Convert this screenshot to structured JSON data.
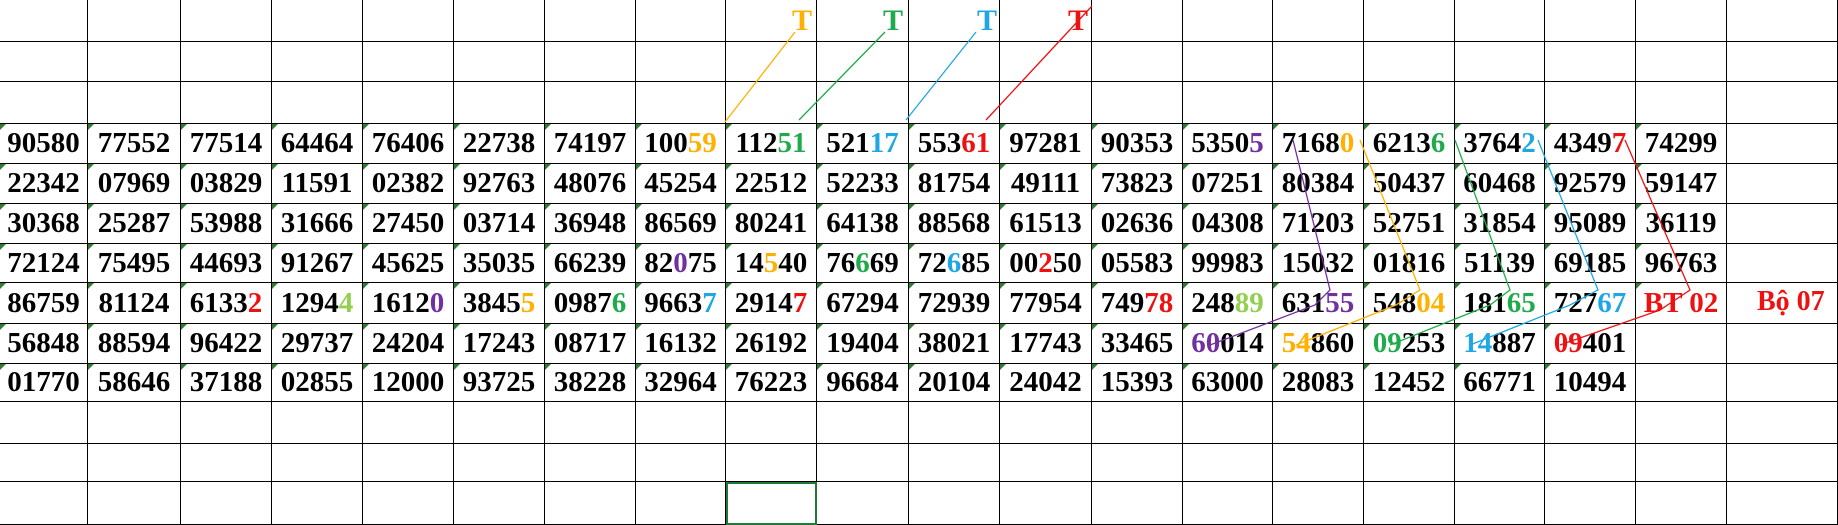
{
  "colors": {
    "orange": "#ffb000",
    "green": "#1faa4b",
    "blue": "#1ea7e4",
    "red": "#ee1111",
    "purple": "#7030a0",
    "lime": "#92d050",
    "black": "#000000",
    "grid": "#000000",
    "cell_marker": "#2e7d32"
  },
  "top_marks": [
    {
      "text": "T",
      "col": 8,
      "color": "orange"
    },
    {
      "text": "T",
      "col": 9,
      "color": "green"
    },
    {
      "text": "T",
      "col": 10,
      "color": "blue"
    },
    {
      "text": "T",
      "col": 11,
      "color": "red"
    }
  ],
  "rows": [
    [
      [
        {
          "t": "90580"
        }
      ],
      [
        {
          "t": "77552"
        }
      ],
      [
        {
          "t": "77514"
        }
      ],
      [
        {
          "t": "64464"
        }
      ],
      [
        {
          "t": "76406"
        }
      ],
      [
        {
          "t": "22738"
        }
      ],
      [
        {
          "t": "74197"
        }
      ],
      [
        {
          "t": "100"
        },
        {
          "t": "59",
          "c": "orange"
        }
      ],
      [
        {
          "t": "112"
        },
        {
          "t": "51",
          "c": "green"
        }
      ],
      [
        {
          "t": "521"
        },
        {
          "t": "17",
          "c": "blue"
        }
      ],
      [
        {
          "t": "553"
        },
        {
          "t": "61",
          "c": "red"
        }
      ],
      [
        {
          "t": "97281"
        }
      ],
      [
        {
          "t": "90353"
        }
      ],
      [
        {
          "t": "5350"
        },
        {
          "t": "5",
          "c": "purple"
        }
      ],
      [
        {
          "t": "7168"
        },
        {
          "t": "0",
          "c": "orange"
        }
      ],
      [
        {
          "t": "6213"
        },
        {
          "t": "6",
          "c": "green"
        }
      ],
      [
        {
          "t": "3764"
        },
        {
          "t": "2",
          "c": "blue"
        }
      ],
      [
        {
          "t": "4349"
        },
        {
          "t": "7",
          "c": "red"
        }
      ],
      [
        {
          "t": "74299"
        }
      ],
      [
        {
          "t": ""
        }
      ]
    ],
    [
      [
        {
          "t": "22342"
        }
      ],
      [
        {
          "t": "07969"
        }
      ],
      [
        {
          "t": "03829"
        }
      ],
      [
        {
          "t": "11591"
        }
      ],
      [
        {
          "t": "02382"
        }
      ],
      [
        {
          "t": "92763"
        }
      ],
      [
        {
          "t": "48076"
        }
      ],
      [
        {
          "t": "45254"
        }
      ],
      [
        {
          "t": "22512"
        }
      ],
      [
        {
          "t": "52233"
        }
      ],
      [
        {
          "t": "81754"
        }
      ],
      [
        {
          "t": "49111"
        }
      ],
      [
        {
          "t": "73823"
        }
      ],
      [
        {
          "t": "07251"
        }
      ],
      [
        {
          "t": "80384"
        }
      ],
      [
        {
          "t": "50437"
        }
      ],
      [
        {
          "t": "60468"
        }
      ],
      [
        {
          "t": "92579"
        }
      ],
      [
        {
          "t": "59147"
        }
      ],
      [
        {
          "t": ""
        }
      ]
    ],
    [
      [
        {
          "t": "30368"
        }
      ],
      [
        {
          "t": "25287"
        }
      ],
      [
        {
          "t": "53988"
        }
      ],
      [
        {
          "t": "31666"
        }
      ],
      [
        {
          "t": "27450"
        }
      ],
      [
        {
          "t": "03714"
        }
      ],
      [
        {
          "t": "36948"
        }
      ],
      [
        {
          "t": "86569"
        }
      ],
      [
        {
          "t": "80241"
        }
      ],
      [
        {
          "t": "64138"
        }
      ],
      [
        {
          "t": "88568"
        }
      ],
      [
        {
          "t": "61513"
        }
      ],
      [
        {
          "t": "02636"
        }
      ],
      [
        {
          "t": "04308"
        }
      ],
      [
        {
          "t": "71203"
        }
      ],
      [
        {
          "t": "52751"
        }
      ],
      [
        {
          "t": "31854"
        }
      ],
      [
        {
          "t": "95089"
        }
      ],
      [
        {
          "t": "36119"
        }
      ],
      [
        {
          "t": ""
        }
      ]
    ],
    [
      [
        {
          "t": "72124"
        }
      ],
      [
        {
          "t": "75495"
        }
      ],
      [
        {
          "t": "44693"
        }
      ],
      [
        {
          "t": "91267"
        }
      ],
      [
        {
          "t": "45625"
        }
      ],
      [
        {
          "t": "35035"
        }
      ],
      [
        {
          "t": "66239"
        }
      ],
      [
        {
          "t": "82"
        },
        {
          "t": "0",
          "c": "purple"
        },
        {
          "t": "75"
        }
      ],
      [
        {
          "t": "14"
        },
        {
          "t": "5",
          "c": "orange"
        },
        {
          "t": "40"
        }
      ],
      [
        {
          "t": "76"
        },
        {
          "t": "6",
          "c": "green"
        },
        {
          "t": "69"
        }
      ],
      [
        {
          "t": "72"
        },
        {
          "t": "6",
          "c": "blue"
        },
        {
          "t": "85"
        }
      ],
      [
        {
          "t": "00"
        },
        {
          "t": "2",
          "c": "red"
        },
        {
          "t": "50"
        }
      ],
      [
        {
          "t": "05583"
        }
      ],
      [
        {
          "t": "99983"
        }
      ],
      [
        {
          "t": "15032"
        }
      ],
      [
        {
          "t": "01816"
        }
      ],
      [
        {
          "t": "51139"
        }
      ],
      [
        {
          "t": "69185"
        }
      ],
      [
        {
          "t": "96763"
        }
      ],
      [
        {
          "t": ""
        }
      ]
    ],
    [
      [
        {
          "t": "86759"
        }
      ],
      [
        {
          "t": "81124"
        }
      ],
      [
        {
          "t": "6133"
        },
        {
          "t": "2",
          "c": "red"
        }
      ],
      [
        {
          "t": "1294"
        },
        {
          "t": "4",
          "c": "lime"
        }
      ],
      [
        {
          "t": "1612"
        },
        {
          "t": "0",
          "c": "purple"
        }
      ],
      [
        {
          "t": "3845"
        },
        {
          "t": "5",
          "c": "orange"
        }
      ],
      [
        {
          "t": "0987"
        },
        {
          "t": "6",
          "c": "green"
        }
      ],
      [
        {
          "t": "9663"
        },
        {
          "t": "7",
          "c": "blue"
        }
      ],
      [
        {
          "t": "2914"
        },
        {
          "t": "7",
          "c": "red"
        }
      ],
      [
        {
          "t": "67294"
        }
      ],
      [
        {
          "t": "72939"
        }
      ],
      [
        {
          "t": "77954"
        }
      ],
      [
        {
          "t": "749"
        },
        {
          "t": "78",
          "c": "red"
        }
      ],
      [
        {
          "t": "248"
        },
        {
          "t": "89",
          "c": "lime"
        }
      ],
      [
        {
          "t": "631"
        },
        {
          "t": "55",
          "c": "purple"
        }
      ],
      [
        {
          "t": "548"
        },
        {
          "t": "04",
          "c": "orange"
        }
      ],
      [
        {
          "t": "181"
        },
        {
          "t": "65",
          "c": "green"
        }
      ],
      [
        {
          "t": "727"
        },
        {
          "t": "67",
          "c": "blue"
        }
      ],
      [
        {
          "t": "BT 02",
          "c": "red"
        }
      ],
      [
        {
          "t": ""
        }
      ]
    ],
    [
      [
        {
          "t": "56848"
        }
      ],
      [
        {
          "t": "88594"
        }
      ],
      [
        {
          "t": "96422"
        }
      ],
      [
        {
          "t": "29737"
        }
      ],
      [
        {
          "t": "24204"
        }
      ],
      [
        {
          "t": "17243"
        }
      ],
      [
        {
          "t": "08717"
        }
      ],
      [
        {
          "t": "16132"
        }
      ],
      [
        {
          "t": "26192"
        }
      ],
      [
        {
          "t": "19404"
        }
      ],
      [
        {
          "t": "38021"
        }
      ],
      [
        {
          "t": "17743"
        }
      ],
      [
        {
          "t": "33465"
        }
      ],
      [
        {
          "t": "60",
          "c": "purple"
        },
        {
          "t": "014"
        }
      ],
      [
        {
          "t": "54",
          "c": "orange"
        },
        {
          "t": "860"
        }
      ],
      [
        {
          "t": "09",
          "c": "green"
        },
        {
          "t": "253"
        }
      ],
      [
        {
          "t": "14",
          "c": "blue"
        },
        {
          "t": "887"
        }
      ],
      [
        {
          "t": "09",
          "c": "red"
        },
        {
          "t": "401"
        }
      ],
      [
        {
          "t": ""
        }
      ],
      [
        {
          "t": ""
        }
      ]
    ],
    [
      [
        {
          "t": "01770"
        }
      ],
      [
        {
          "t": "58646"
        }
      ],
      [
        {
          "t": "37188"
        }
      ],
      [
        {
          "t": "02855"
        }
      ],
      [
        {
          "t": "12000"
        }
      ],
      [
        {
          "t": "93725"
        }
      ],
      [
        {
          "t": "38228"
        }
      ],
      [
        {
          "t": "32964"
        }
      ],
      [
        {
          "t": "76223"
        }
      ],
      [
        {
          "t": "96684"
        }
      ],
      [
        {
          "t": "20104"
        }
      ],
      [
        {
          "t": "24042"
        }
      ],
      [
        {
          "t": "15393"
        }
      ],
      [
        {
          "t": "63000"
        }
      ],
      [
        {
          "t": "28083"
        }
      ],
      [
        {
          "t": "12452"
        }
      ],
      [
        {
          "t": "66771"
        }
      ],
      [
        {
          "t": "10494"
        }
      ],
      [
        {
          "t": ""
        }
      ],
      [
        {
          "t": ""
        }
      ]
    ]
  ],
  "side_label": {
    "text": "Bộ 07",
    "color": "red"
  },
  "selected_cell": {
    "row": 12,
    "col": 8
  }
}
